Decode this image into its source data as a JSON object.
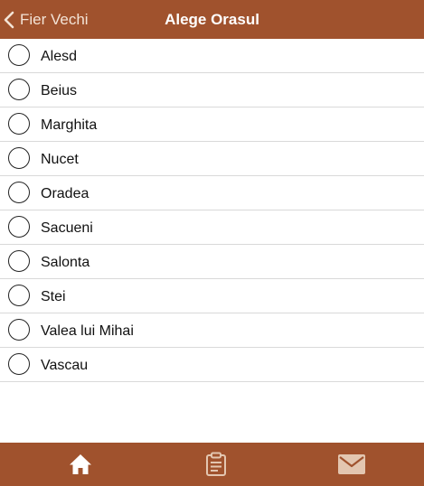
{
  "navbar": {
    "back_label": "Fier Vechi",
    "title": "Alege Orasul"
  },
  "cities": [
    {
      "label": "Alesd",
      "selected": false
    },
    {
      "label": "Beius",
      "selected": false
    },
    {
      "label": "Marghita",
      "selected": false
    },
    {
      "label": "Nucet",
      "selected": false
    },
    {
      "label": "Oradea",
      "selected": false
    },
    {
      "label": "Sacueni",
      "selected": false
    },
    {
      "label": "Salonta",
      "selected": false
    },
    {
      "label": "Stei",
      "selected": false
    },
    {
      "label": "Valea lui Mihai",
      "selected": false
    },
    {
      "label": "Vascau",
      "selected": false
    }
  ],
  "tabbar": {
    "tabs": [
      {
        "icon": "home-icon",
        "active": true
      },
      {
        "icon": "clipboard-icon",
        "active": false
      },
      {
        "icon": "mail-icon",
        "active": false
      }
    ]
  },
  "colors": {
    "brand": "#a0522d",
    "active_icon": "#ffffff",
    "inactive_icon": "#e3c6b0"
  }
}
